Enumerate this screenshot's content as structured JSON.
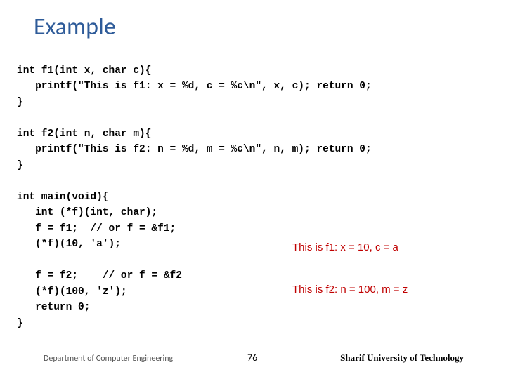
{
  "title": "Example",
  "code": "int f1(int x, char c){\n   printf(\"This is f1: x = %d, c = %c\\n\", x, c); return 0;\n}\n\nint f2(int n, char m){\n   printf(\"This is f2: n = %d, m = %c\\n\", n, m); return 0;\n}\n\nint main(void){\n   int (*f)(int, char);\n   f = f1;  // or f = &f1;\n   (*f)(10, 'a');\n\n   f = f2;    // or f = &f2\n   (*f)(100, 'z');\n   return 0;\n}",
  "output1": "This is f1: x = 10, c = a",
  "output2": "This is f2: n = 100, m = z",
  "footer": {
    "left": "Department of Computer Engineering",
    "page": "76",
    "right": "Sharif University of Technology"
  }
}
